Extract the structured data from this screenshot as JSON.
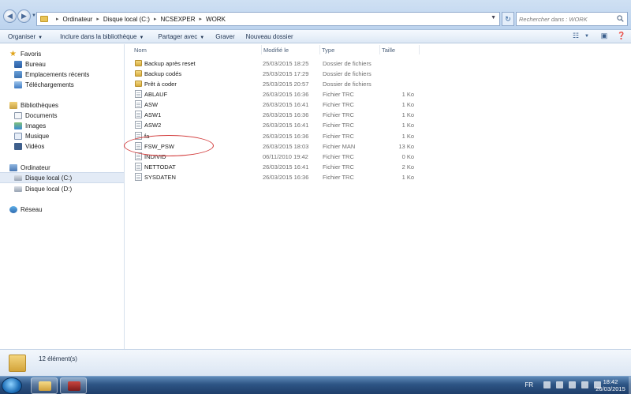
{
  "address": {
    "crumbs": [
      "Ordinateur",
      "Disque local (C:)",
      "NCSEXPER",
      "WORK"
    ],
    "search_placeholder": "Rechercher dans : WORK"
  },
  "toolbar": {
    "organiser": "Organiser",
    "inclure": "Inclure dans la bibliothèque",
    "partager": "Partager avec",
    "graver": "Graver",
    "nouveau_dossier": "Nouveau dossier"
  },
  "nav": {
    "favoris": "Favoris",
    "bureau": "Bureau",
    "emplacements": "Emplacements récents",
    "telechargements": "Téléchargements",
    "bibliotheques": "Bibliothèques",
    "documents": "Documents",
    "images": "Images",
    "musique": "Musique",
    "videos": "Vidéos",
    "ordinateur": "Ordinateur",
    "disque_c": "Disque local (C:)",
    "disque_d": "Disque local (D:)",
    "reseau": "Réseau"
  },
  "columns": {
    "nom": "Nom",
    "modifie": "Modifié le",
    "type": "Type",
    "taille": "Taille"
  },
  "files": [
    {
      "name": "Backup après reset",
      "date": "25/03/2015 18:25",
      "type": "Dossier de fichiers",
      "size": "",
      "kind": "folder"
    },
    {
      "name": "Backup codés",
      "date": "25/03/2015 17:29",
      "type": "Dossier de fichiers",
      "size": "",
      "kind": "folder"
    },
    {
      "name": "Prêt à coder",
      "date": "25/03/2015 20:57",
      "type": "Dossier de fichiers",
      "size": "",
      "kind": "folder"
    },
    {
      "name": "ABLAUF",
      "date": "26/03/2015 16:36",
      "type": "Fichier TRC",
      "size": "1 Ko",
      "kind": "file"
    },
    {
      "name": "ASW",
      "date": "26/03/2015 16:41",
      "type": "Fichier TRC",
      "size": "1 Ko",
      "kind": "file"
    },
    {
      "name": "ASW1",
      "date": "26/03/2015 16:36",
      "type": "Fichier TRC",
      "size": "1 Ko",
      "kind": "file"
    },
    {
      "name": "ASW2",
      "date": "26/03/2015 16:41",
      "type": "Fichier TRC",
      "size": "1 Ko",
      "kind": "file"
    },
    {
      "name": "fa",
      "date": "26/03/2015 16:36",
      "type": "Fichier TRC",
      "size": "1 Ko",
      "kind": "file"
    },
    {
      "name": "FSW_PSW",
      "date": "26/03/2015 18:03",
      "type": "Fichier MAN",
      "size": "13 Ko",
      "kind": "file"
    },
    {
      "name": "INDIVID",
      "date": "06/11/2010 19:42",
      "type": "Fichier TRC",
      "size": "0 Ko",
      "kind": "file"
    },
    {
      "name": "NETTODAT",
      "date": "26/03/2015 16:41",
      "type": "Fichier TRC",
      "size": "2 Ko",
      "kind": "file"
    },
    {
      "name": "SYSDATEN",
      "date": "26/03/2015 16:36",
      "type": "Fichier TRC",
      "size": "1 Ko",
      "kind": "file"
    }
  ],
  "details": {
    "count": "12 élément(s)"
  },
  "taskbar": {
    "lang": "FR",
    "time": "18:42",
    "date": "26/03/2015"
  },
  "colors": {
    "annotation": "#d23a3a",
    "selected_nav": "#e3ebf6"
  }
}
